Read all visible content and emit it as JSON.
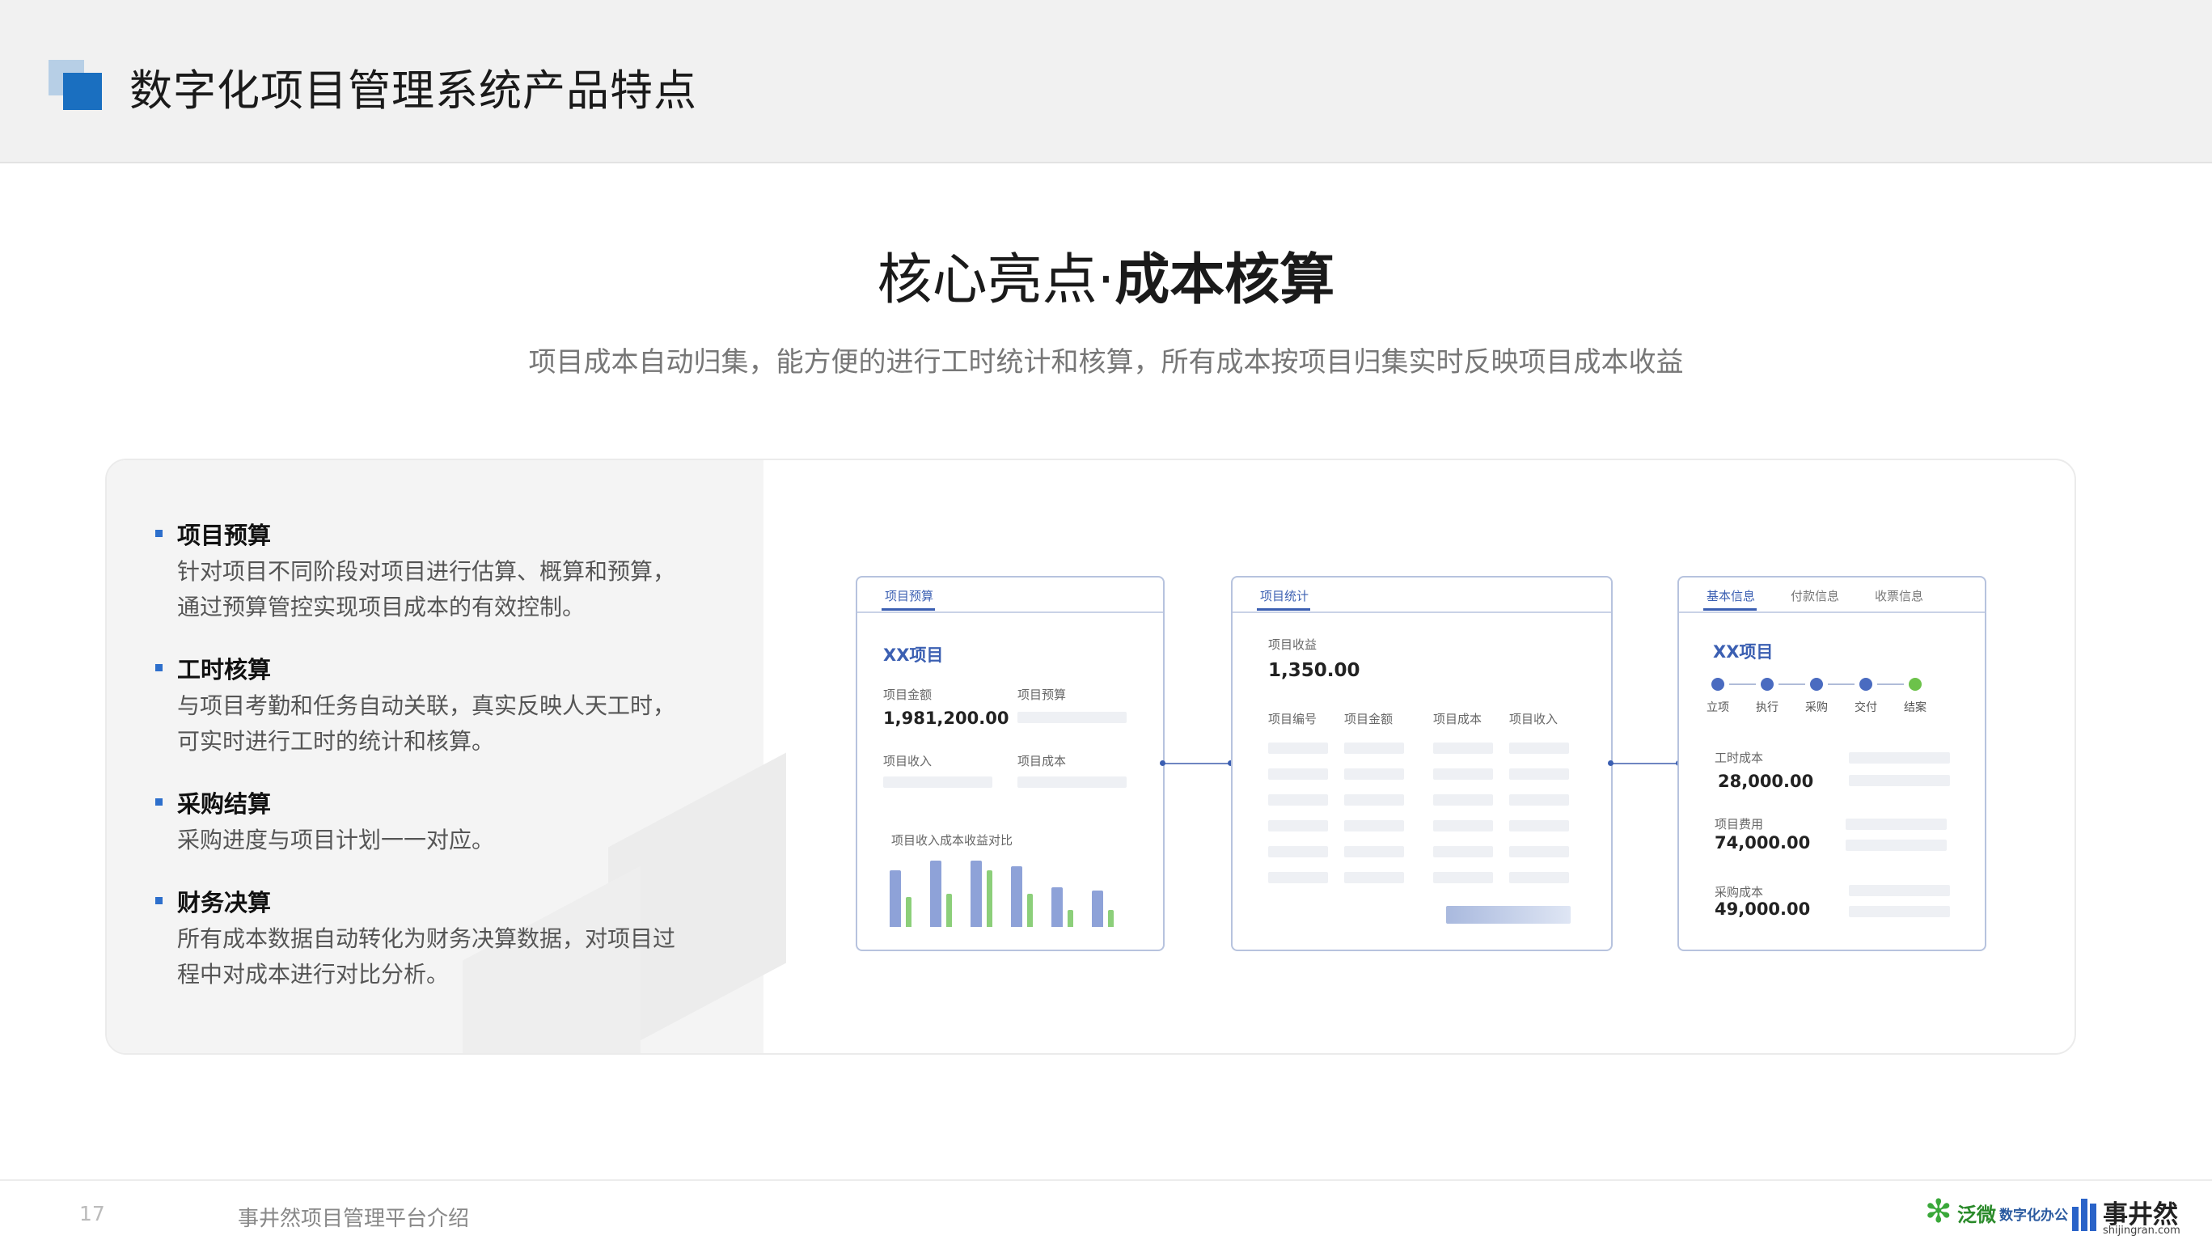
{
  "header": {
    "title": "数字化项目管理系统产品特点"
  },
  "headline": {
    "prefix": "核心亮点·",
    "bold": "成本核算"
  },
  "subline": "项目成本自动归集，能方便的进行工时统计和核算，所有成本按项目归集实时反映项目成本收益",
  "features": [
    {
      "title": "项目预算",
      "desc": "针对项目不同阶段对项目进行估算、概算和预算，通过预算管控实现项目成本的有效控制。"
    },
    {
      "title": "工时核算",
      "desc": "与项目考勤和任务自动关联，真实反映人天工时，可实时进行工时的统计和核算。"
    },
    {
      "title": "采购结算",
      "desc": "采购进度与项目计划一一对应。"
    },
    {
      "title": "财务决算",
      "desc": "所有成本数据自动转化为财务决算数据，对项目过程中对成本进行对比分析。"
    }
  ],
  "panel_budget": {
    "tab": "项目预算",
    "project_name": "XX项目",
    "amount_label": "项目金额",
    "amount_value": "1,981,200.00",
    "budget_label": "项目预算",
    "income_label": "项目收入",
    "cost_label": "项目成本",
    "chart_title": "项目收入成本收益对比",
    "bar_colors": {
      "income": "#8ea2d8",
      "cost": "#8ccf7a"
    },
    "bars": [
      {
        "income": 0.85,
        "cost": 0.45
      },
      {
        "income": 1.0,
        "cost": 0.5
      },
      {
        "income": 1.0,
        "cost": 0.85
      },
      {
        "income": 0.92,
        "cost": 0.5
      },
      {
        "income": 0.6,
        "cost": 0.25
      },
      {
        "income": 0.55,
        "cost": 0.25
      }
    ]
  },
  "panel_stats": {
    "tab": "项目统计",
    "income_label": "项目收益",
    "income_value": "1,350.00",
    "columns": [
      "项目编号",
      "项目金额",
      "项目成本",
      "项目收入"
    ]
  },
  "panel_info": {
    "tabs": [
      "基本信息",
      "付款信息",
      "收票信息"
    ],
    "project_name": "XX项目",
    "steps": [
      "立项",
      "执行",
      "采购",
      "交付",
      "结案"
    ],
    "step_colors": {
      "normal": "#4a6bc0",
      "final": "#6cc24a"
    },
    "rows": [
      {
        "label": "工时成本",
        "value": "28,000.00"
      },
      {
        "label": "项目费用",
        "value": "74,000.00"
      },
      {
        "label": "采购成本",
        "value": "49,000.00"
      }
    ]
  },
  "footer": {
    "page_number": "17",
    "text": "事井然项目管理平台介绍",
    "logo_fanwei": {
      "name": "泛微",
      "sub": "数字化办公"
    },
    "logo_sjr": {
      "name": "事井然",
      "domain": "shijingran.com"
    }
  }
}
